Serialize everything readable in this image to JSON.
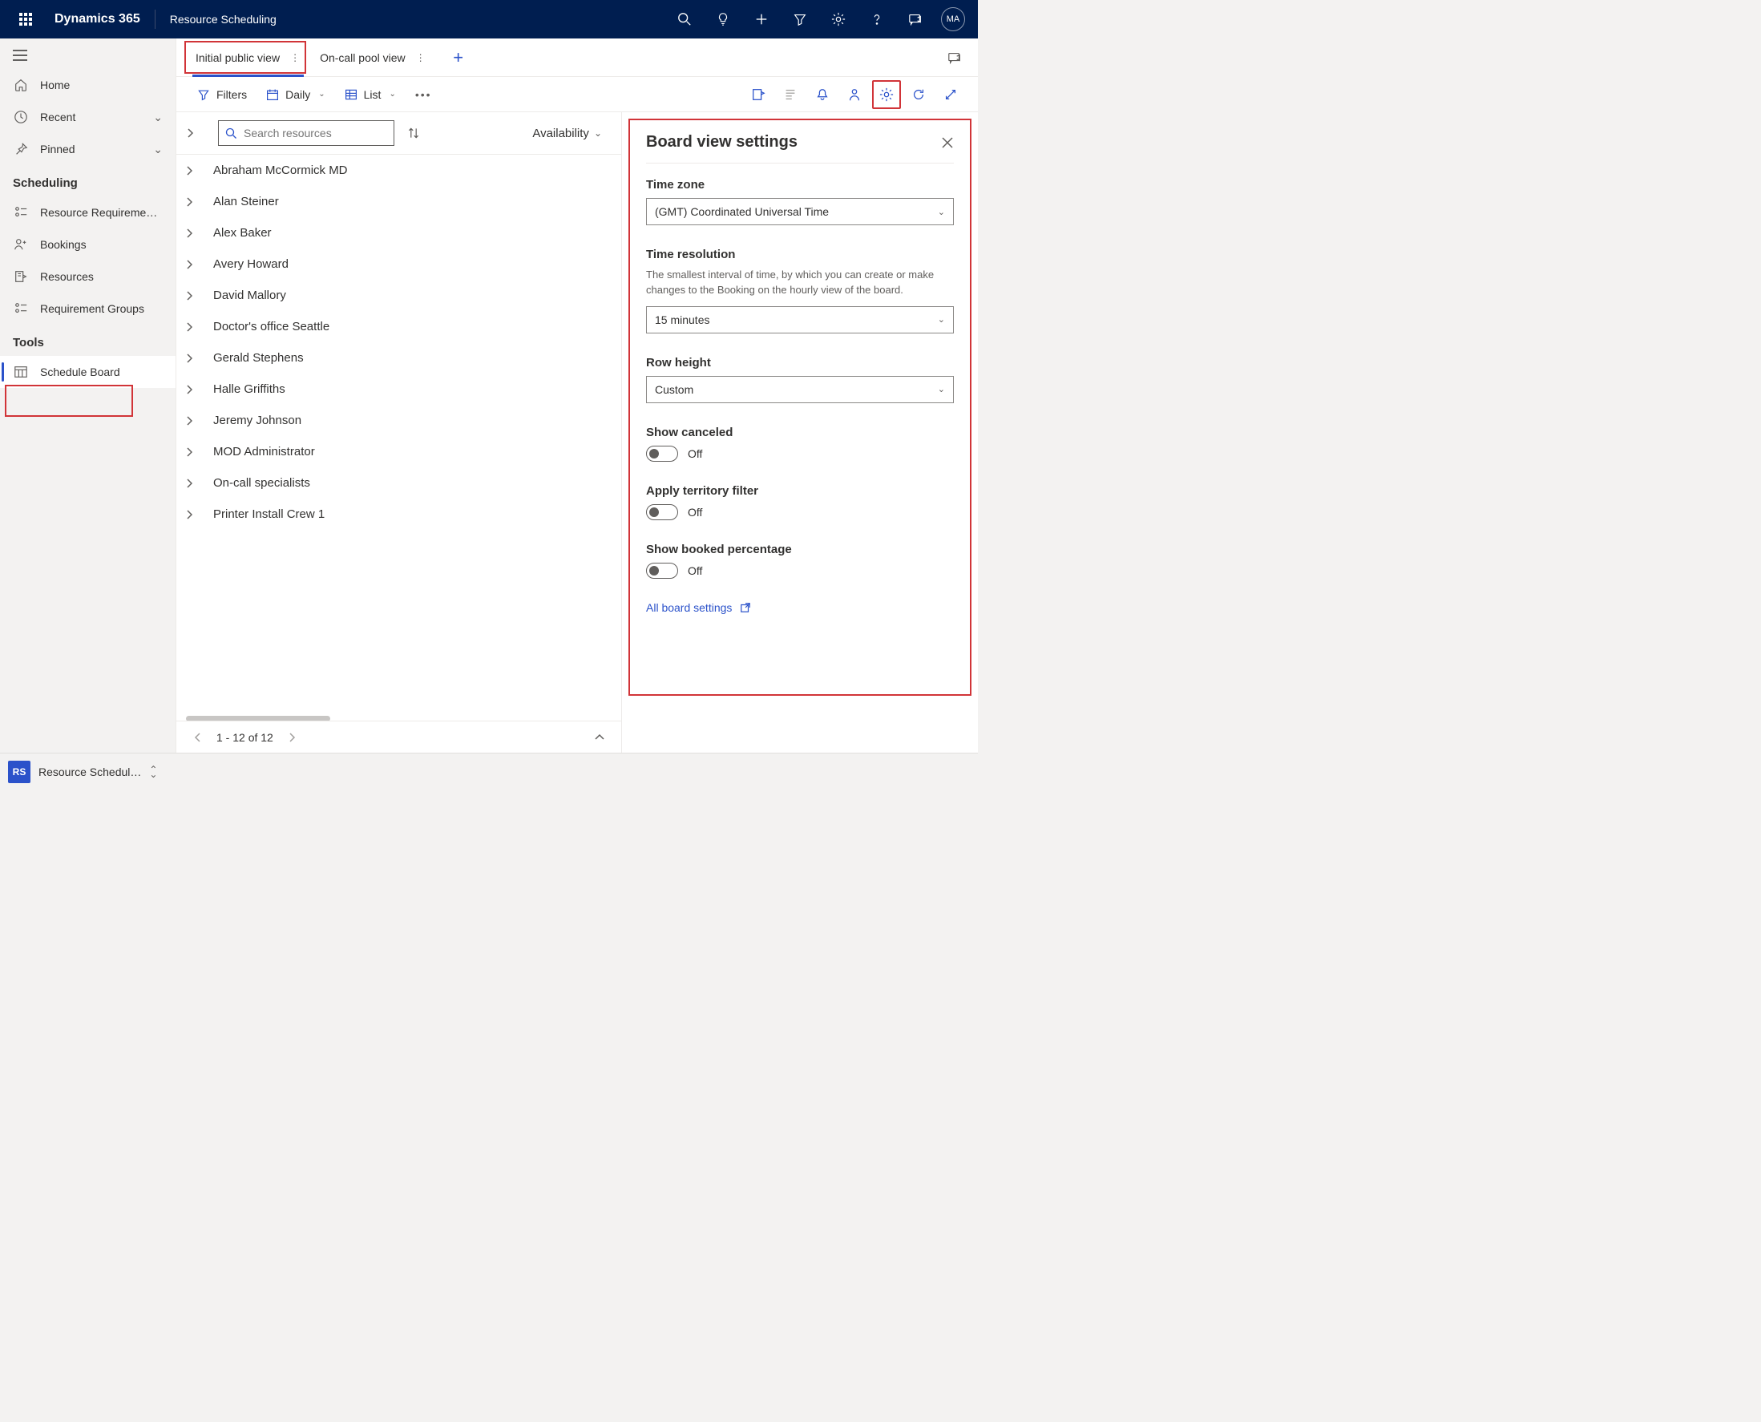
{
  "header": {
    "brand": "Dynamics 365",
    "app": "Resource Scheduling",
    "avatar_initials": "MA"
  },
  "sidebar": {
    "home": "Home",
    "recent": "Recent",
    "pinned": "Pinned",
    "section_scheduling": "Scheduling",
    "items_scheduling": [
      "Resource Requireme…",
      "Bookings",
      "Resources",
      "Requirement Groups"
    ],
    "section_tools": "Tools",
    "schedule_board": "Schedule Board"
  },
  "tabs": {
    "active": "Initial public view",
    "other": "On-call pool view"
  },
  "toolbar": {
    "filters": "Filters",
    "daily": "Daily",
    "list": "List"
  },
  "resources": {
    "search_placeholder": "Search resources",
    "availability": "Availability",
    "rows": [
      "Abraham McCormick MD",
      "Alan Steiner",
      "Alex Baker",
      "Avery Howard",
      "David Mallory",
      "Doctor's office Seattle",
      "Gerald Stephens",
      "Halle Griffiths",
      "Jeremy Johnson",
      "MOD Administrator",
      "On-call specialists",
      "Printer Install Crew 1"
    ]
  },
  "settings": {
    "title": "Board view settings",
    "timezone_label": "Time zone",
    "timezone_value": "(GMT) Coordinated Universal Time",
    "timeres_label": "Time resolution",
    "timeres_help": "The smallest interval of time, by which you can create or make changes to the Booking on the hourly view of the board.",
    "timeres_value": "15 minutes",
    "rowheight_label": "Row height",
    "rowheight_value": "Custom",
    "show_canceled": "Show canceled",
    "apply_territory": "Apply territory filter",
    "show_booked": "Show booked percentage",
    "toggle_off": "Off",
    "all_settings": "All board settings"
  },
  "pagination": "1 - 12 of 12",
  "bottom": {
    "badge": "RS",
    "label": "Resource Schedul…"
  }
}
